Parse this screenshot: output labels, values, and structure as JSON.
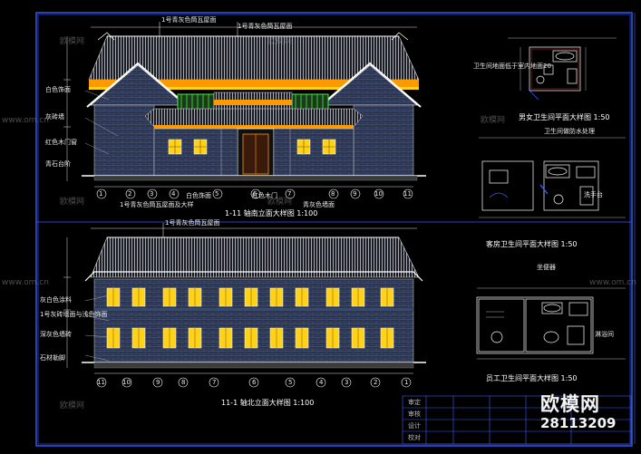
{
  "watermark": {
    "brand": "欧模网",
    "site": "www.om.cn",
    "logo_text": "欧模网",
    "logo_id": "28113209"
  },
  "front_elevation": {
    "title": "1-11 轴南立面大样图 1:100",
    "top_labels": [
      "1号青灰色筒瓦屋面",
      "1号青灰色筒瓦屋面"
    ],
    "left_notes": [
      "白色饰面",
      "灰砖墙",
      "红色木门窗",
      "青石台阶"
    ],
    "bottom_labels": [
      "1号青灰色筒瓦屋面及大样",
      "白色饰面",
      "红色木门",
      "青灰色墙面"
    ],
    "axes": [
      "1",
      "2",
      "3",
      "4",
      "5",
      "6",
      "7",
      "8",
      "9",
      "10",
      "11"
    ]
  },
  "back_elevation": {
    "title": "11-1 轴北立面大样图 1:100",
    "top_label": "1号青灰色筒瓦屋面",
    "left_notes": [
      "灰白色涂料",
      "1号灰砖墙面与浅色饰面",
      "深灰色墙砖",
      "石材勒脚"
    ],
    "axes": [
      "11",
      "10",
      "9",
      "8",
      "7",
      "6",
      "5",
      "4",
      "3",
      "2",
      "1"
    ]
  },
  "bath_details": {
    "plan_a_title": "男女卫生间平面大样图 1:50",
    "plan_b_title": "客房卫生间平面大样图 1:50",
    "plan_c_title": "员工卫生间平面大样图 1:50",
    "notes": [
      "卫生间地面低于室内地面20",
      "卫生间做防水处理",
      "洗手台",
      "坐便器",
      "淋浴间"
    ]
  },
  "title_block": {
    "labels": [
      "审定",
      "审核",
      "设计",
      "校对"
    ],
    "values": [
      "",
      "",
      "",
      ""
    ]
  },
  "colors": {
    "background": "#000000",
    "frame": "#3a5cff",
    "roof": "#9aa0a8",
    "wall": "#2c3a55",
    "window": "#ffd21a",
    "accent_green": "#44ee44",
    "wood": "#ff9900"
  }
}
